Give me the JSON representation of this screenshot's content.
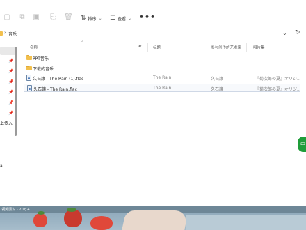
{
  "toolbar": {
    "sort_label": "排序",
    "view_label": "查看",
    "more_label": "•••"
  },
  "address": {
    "path": "音乐"
  },
  "nav": {
    "fragments": [
      "上传入",
      "al"
    ]
  },
  "columns": {
    "name": "名称",
    "number": "#",
    "title": "标题",
    "artists": "参与创作的艺术家",
    "album": "唱片集"
  },
  "rows": [
    {
      "type": "folder",
      "name": "PPT音乐",
      "number": "",
      "title": "",
      "artist": "",
      "album": ""
    },
    {
      "type": "folder",
      "name": "下载的音乐",
      "number": "",
      "title": "",
      "artist": "",
      "album": ""
    },
    {
      "type": "file",
      "name": "久石譲 - The Rain (1).flac",
      "number": "",
      "title": "The Rain",
      "artist": "久石譲",
      "album": "『菊次郎の夏』オリジ..."
    },
    {
      "type": "file",
      "name": "久石譲 - The Rain.flac",
      "number": "",
      "title": "The Rain",
      "artist": "久石譲",
      "album": "『菊次郎の夏』オリジ...",
      "selected": true
    }
  ],
  "side_badge": "中",
  "photo_caption": "?视频素材 · 20万+"
}
